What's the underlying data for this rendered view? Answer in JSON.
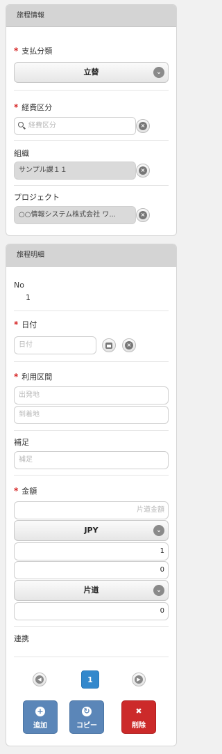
{
  "travel_info": {
    "title": "旅程情報",
    "payment_type": {
      "label": "支払分類",
      "value": "立替"
    },
    "expense_type": {
      "label": "経費区分",
      "placeholder": "経費区分"
    },
    "organization": {
      "label": "組織",
      "value": "サンプル課１１"
    },
    "project": {
      "label": "プロジェクト",
      "value": "○○情報システム株式会社 ワ..."
    }
  },
  "travel_detail": {
    "title": "旅程明細",
    "no": {
      "label": "No",
      "value": "1"
    },
    "date": {
      "label": "日付",
      "placeholder": "日付"
    },
    "route": {
      "label": "利用区間",
      "from_placeholder": "出発地",
      "to_placeholder": "到着地"
    },
    "note": {
      "label": "補足",
      "placeholder": "補足"
    },
    "amount": {
      "label": "金額",
      "oneway_placeholder": "片道金額",
      "currency": "JPY",
      "rate": "1",
      "converted": "0",
      "trip_type": "片道",
      "total": "0"
    },
    "link": {
      "label": "連携"
    }
  },
  "pager": {
    "current_page": "1"
  },
  "actions": {
    "add": "追加",
    "copy": "コピー",
    "delete": "削除"
  },
  "colors": {
    "add": "#5b86b8",
    "copy": "#5b86b8",
    "delete": "#cc2a2a",
    "page": "#3388cc",
    "required": "#d62626"
  }
}
